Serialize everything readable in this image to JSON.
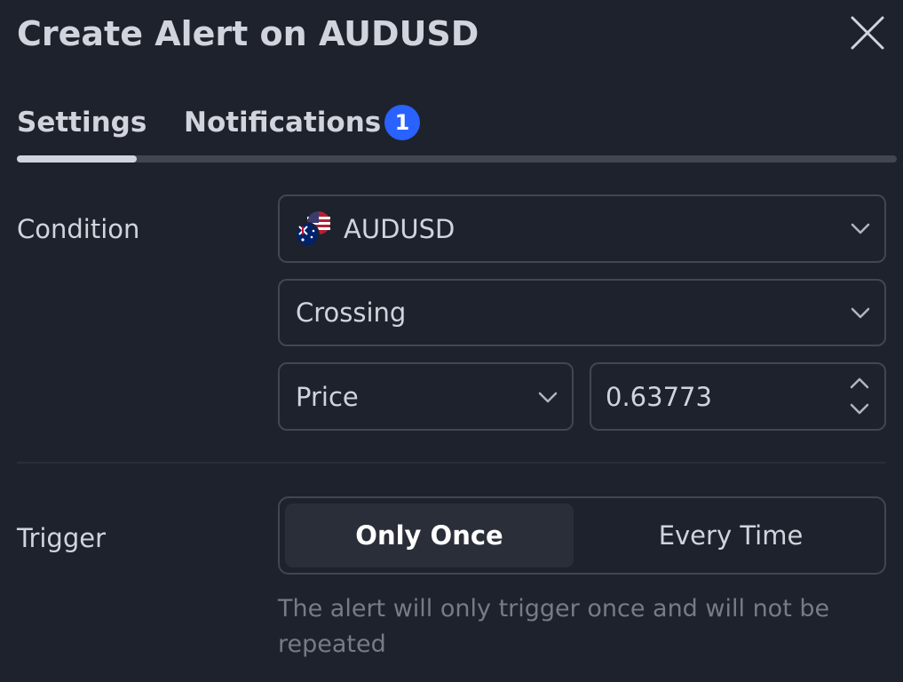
{
  "dialog": {
    "title": "Create Alert on AUDUSD",
    "close_icon": "close-icon"
  },
  "tabs": [
    {
      "label": "Settings",
      "active": true
    },
    {
      "label": "Notifications",
      "badge": "1"
    }
  ],
  "condition": {
    "label": "Condition",
    "symbol": "AUDUSD",
    "symbol_icon": "flag-au-us-icon",
    "operator": "Crossing",
    "source": "Price",
    "value": "0.63773"
  },
  "trigger": {
    "label": "Trigger",
    "options": [
      "Only Once",
      "Every Time"
    ],
    "selected": "Only Once",
    "description": "The alert will only trigger once and will not be repeated"
  },
  "colors": {
    "background": "#1e222d",
    "text": "#d1d4dc",
    "muted": "#787b86",
    "border": "#434651",
    "accent": "#2962ff"
  }
}
